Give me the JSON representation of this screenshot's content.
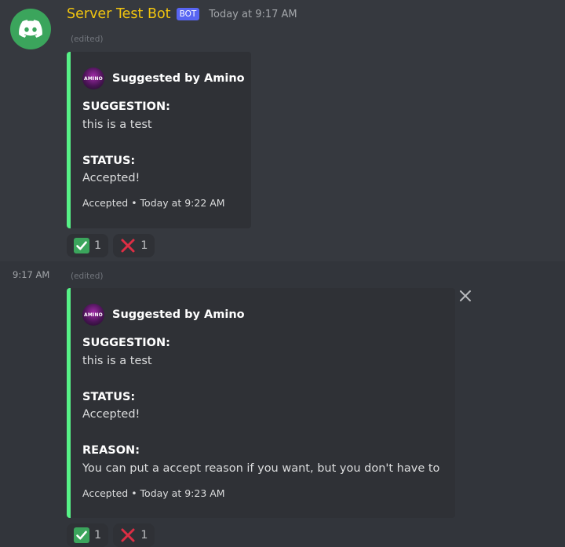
{
  "message": {
    "username": "Server Test Bot",
    "bot_tag": "BOT",
    "timestamp": "Today at 9:17 AM",
    "edited_label": "(edited)",
    "side_time": "9:17 AM"
  },
  "embeds": [
    {
      "author_icon_text": "AMINO",
      "author_name": "Suggested by Amino",
      "fields": [
        {
          "name": "SUGGESTION:",
          "value": "this is a test"
        },
        {
          "name": "STATUS:",
          "value": "Accepted!"
        }
      ],
      "footer": "Accepted • Today at 9:22 AM",
      "reactions": [
        {
          "icon": "check-mark-icon",
          "count": "1"
        },
        {
          "icon": "cross-mark-icon",
          "count": "1"
        }
      ]
    },
    {
      "author_icon_text": "AMINO",
      "author_name": "Suggested by Amino",
      "fields": [
        {
          "name": "SUGGESTION:",
          "value": "this is a test"
        },
        {
          "name": "STATUS:",
          "value": "Accepted!"
        },
        {
          "name": "REASON:",
          "value": "You can put a accept reason if you want, but you don't have to"
        }
      ],
      "footer": "Accepted • Today at 9:23 AM",
      "reactions": [
        {
          "icon": "check-mark-icon",
          "count": "1"
        },
        {
          "icon": "cross-mark-icon",
          "count": "1"
        }
      ]
    }
  ],
  "colors": {
    "username": "#f1c40f",
    "bot_tag": "#5865f2",
    "embed_border": "#57f287",
    "avatar_bg": "#3ba55c",
    "check_bg": "#3ba55c",
    "cross": "#dd2e44"
  },
  "icons": {
    "avatar": "discord-logo-icon",
    "close": "close-icon"
  }
}
